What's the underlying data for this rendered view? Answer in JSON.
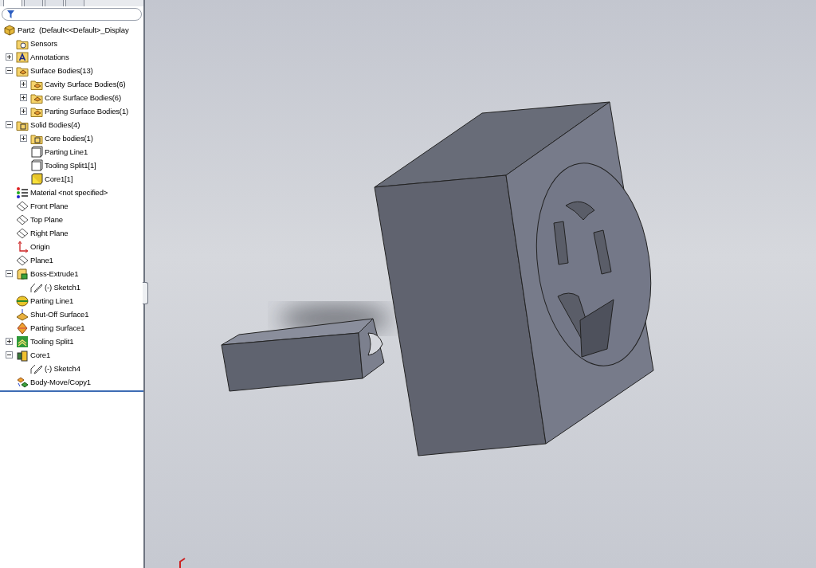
{
  "tree": {
    "tabs": [
      {
        "selected": true
      },
      {
        "selected": false
      },
      {
        "selected": false
      },
      {
        "selected": false
      }
    ],
    "items": [
      {
        "label": "Part2  (Default<<Default>_Display",
        "kind": "part",
        "children": [
          {
            "label": "Sensors",
            "kind": "sensors"
          },
          {
            "label": "Annotations",
            "kind": "annotations",
            "expanded": false
          },
          {
            "label": "Surface Bodies(13)",
            "kind": "surface-folder",
            "expanded": true,
            "children": [
              {
                "label": "Cavity Surface Bodies(6)",
                "kind": "surface-folder",
                "expanded": false
              },
              {
                "label": "Core Surface Bodies(6)",
                "kind": "surface-folder",
                "expanded": false
              },
              {
                "label": "Parting Surface Bodies(1)",
                "kind": "surface-folder",
                "expanded": false
              }
            ]
          },
          {
            "label": "Solid Bodies(4)",
            "kind": "solid-folder",
            "expanded": true,
            "children": [
              {
                "label": "Core bodies(1)",
                "kind": "solid-folder",
                "expanded": false
              },
              {
                "label": "Parting Line1",
                "kind": "body"
              },
              {
                "label": "Tooling Split1[1]",
                "kind": "body"
              },
              {
                "label": "Core1[1]",
                "kind": "core-body"
              }
            ]
          },
          {
            "label": "Material <not specified>",
            "kind": "material"
          },
          {
            "label": "Front Plane",
            "kind": "plane"
          },
          {
            "label": "Top Plane",
            "kind": "plane"
          },
          {
            "label": "Right Plane",
            "kind": "plane"
          },
          {
            "label": "Origin",
            "kind": "origin"
          },
          {
            "label": "Plane1",
            "kind": "plane"
          },
          {
            "label": "Boss-Extrude1",
            "kind": "extrude",
            "expanded": true,
            "children": [
              {
                "label": "(-) Sketch1",
                "kind": "sketch"
              }
            ]
          },
          {
            "label": "Parting Line1",
            "kind": "parting-line"
          },
          {
            "label": "Shut-Off Surface1",
            "kind": "shutoff"
          },
          {
            "label": "Parting Surface1",
            "kind": "parting-surface"
          },
          {
            "label": "Tooling Split1",
            "kind": "tooling-split",
            "expanded": false
          },
          {
            "label": "Core1",
            "kind": "core",
            "expanded": true,
            "children": [
              {
                "label": "(-) Sketch4",
                "kind": "sketch"
              }
            ]
          },
          {
            "label": "Body-Move/Copy1",
            "kind": "move-copy"
          }
        ]
      }
    ]
  }
}
